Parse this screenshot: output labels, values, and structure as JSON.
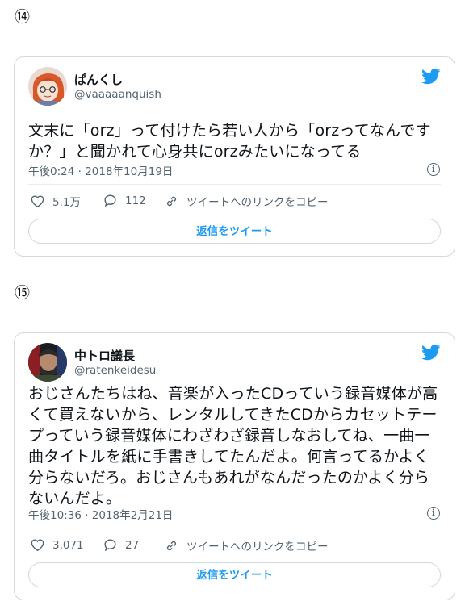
{
  "tweets": [
    {
      "number": "⑭",
      "name": "ぱんくし",
      "handle": "@vaaaaanquish",
      "text": "文末に「orz」って付けたら若い人から「orzってなんですか？」と聞かれて心身共にorzみたいになってる",
      "time": "午後0:24 · 2018年10月19日",
      "likes": "5.1万",
      "replies": "112",
      "copy_link": "ツイートへのリンクをコピー",
      "reply_button": "返信をツイート"
    },
    {
      "number": "⑮",
      "name": "中トロ議長",
      "handle": "@ratenkeidesu",
      "text": "おじさんたちはね、音楽が入ったCDっていう録音媒体が高くて買えないから、レンタルしてきたCDからカセットテープっていう録音媒体にわざわざ録音しなおしてね、一曲一曲タイトルを紙に手書きしてたんだよ。何言ってるかよく分らないだろ。おじさんもあれがなんだったのかよく分らないんだよ。",
      "time": "午後10:36 · 2018年2月21日",
      "likes": "3,071",
      "replies": "27",
      "copy_link": "ツイートへのリンクをコピー",
      "reply_button": "返信をツイート"
    }
  ],
  "colors": {
    "accent": "#1d9bf0",
    "muted": "#536471",
    "border": "#cfd9de"
  },
  "icons": [
    "twitter-bird-icon",
    "heart-icon",
    "reply-bubble-icon",
    "link-icon",
    "info-icon"
  ]
}
